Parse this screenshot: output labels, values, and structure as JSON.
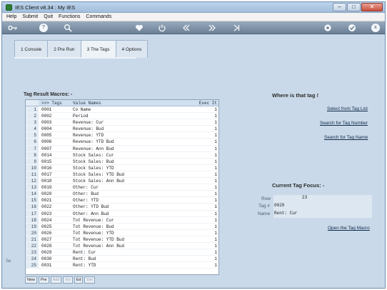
{
  "window": {
    "title": "IES Client v8.34 : My IES",
    "controls": {
      "minimize": "–",
      "maximize": "□",
      "close": "✕"
    }
  },
  "menubar": [
    "Help",
    "Submit",
    "Quit",
    "Functions",
    "Commands"
  ],
  "toolbar": {
    "icons": [
      "key-icon",
      "help-icon",
      "search-icon",
      "heart-icon",
      "power-icon",
      "rewind-icon",
      "forward-icon",
      "end-icon",
      "settings-icon",
      "ok-icon",
      "close-icon"
    ],
    "help_glyph": "?",
    "close_glyph": "x"
  },
  "tabs": [
    {
      "label": "1 Console",
      "active": false
    },
    {
      "label": "2 Pre Run",
      "active": false
    },
    {
      "label": "3 The Tags",
      "active": true
    },
    {
      "label": "4 Options",
      "active": false
    }
  ],
  "left_panel": {
    "heading": "Tag Result Macros: -",
    "columns": {
      "num": "",
      "tags": ">>> Tags",
      "value_names": "Value Names",
      "exec": "Exec It"
    },
    "rows": [
      {
        "num": "1",
        "tag": "0001",
        "name": "Co Name",
        "exec": "1"
      },
      {
        "num": "2",
        "tag": "0002",
        "name": "Period",
        "exec": "1"
      },
      {
        "num": "3",
        "tag": "0003",
        "name": "Revenue: Cur",
        "exec": "1"
      },
      {
        "num": "4",
        "tag": "0004",
        "name": "Revenue: Bud",
        "exec": "1"
      },
      {
        "num": "5",
        "tag": "0005",
        "name": "Revenue: YTD",
        "exec": "1"
      },
      {
        "num": "6",
        "tag": "0006",
        "name": "Revenue: YTD Bud",
        "exec": "1"
      },
      {
        "num": "7",
        "tag": "0007",
        "name": "Revenue: Ann Bud",
        "exec": "1"
      },
      {
        "num": "8",
        "tag": "0014",
        "name": "Stock Sales: Cur",
        "exec": "1"
      },
      {
        "num": "9",
        "tag": "0015",
        "name": "Stock Sales: Bud",
        "exec": "1"
      },
      {
        "num": "10",
        "tag": "0016",
        "name": "Stock Sales: YTD",
        "exec": "1"
      },
      {
        "num": "11",
        "tag": "0017",
        "name": "Stock Sales: YTD Bud",
        "exec": "1"
      },
      {
        "num": "12",
        "tag": "0018",
        "name": "Stock Sales: Ann Bud",
        "exec": "1"
      },
      {
        "num": "13",
        "tag": "0019",
        "name": "Other: Cur",
        "exec": "1"
      },
      {
        "num": "14",
        "tag": "0020",
        "name": "Other: Bud",
        "exec": "1"
      },
      {
        "num": "15",
        "tag": "0021",
        "name": "Other: YTD",
        "exec": "1"
      },
      {
        "num": "16",
        "tag": "0022",
        "name": "Other: YTD Bud",
        "exec": "1"
      },
      {
        "num": "17",
        "tag": "0023",
        "name": "Other: Ann Bud",
        "exec": "1"
      },
      {
        "num": "18",
        "tag": "0024",
        "name": "Tot Revenue: Cur",
        "exec": "1"
      },
      {
        "num": "19",
        "tag": "0025",
        "name": "Tot Revenue: Bud",
        "exec": "1"
      },
      {
        "num": "20",
        "tag": "0026",
        "name": "Tot Revenue: YTD",
        "exec": "1"
      },
      {
        "num": "21",
        "tag": "0027",
        "name": "Tot Revenue: YTD Bud",
        "exec": "1"
      },
      {
        "num": "22",
        "tag": "0028",
        "name": "Tot Revenue: Ann Bud",
        "exec": "1"
      },
      {
        "num": "23",
        "tag": "0029",
        "name": "Rent: Cur",
        "exec": "1"
      },
      {
        "num": "24",
        "tag": "0030",
        "name": "Rent: Bud",
        "exec": "1"
      },
      {
        "num": "25",
        "tag": "0031",
        "name": "Rent: YTD",
        "exec": "1"
      }
    ],
    "nav_buttons": [
      {
        "label": "New",
        "enabled": true
      },
      {
        "label": "Pre",
        "enabled": true
      },
      {
        "label": "Add",
        "enabled": false
      },
      {
        "label": "Ins",
        "enabled": false
      },
      {
        "label": "Ed",
        "enabled": true
      },
      {
        "label": "Del",
        "enabled": false
      }
    ],
    "side_cut_text": "Se"
  },
  "right_panel": {
    "where_heading": "Where is that tag !",
    "links": {
      "select_from_list": "Select from Tag List",
      "search_number": "Search for Tag Number",
      "search_name": "Search for Tag Name",
      "open_macro": "Open the Tag Macro"
    },
    "focus": {
      "heading": "Current Tag Focus: -",
      "row_label": "Row",
      "row_value": "23",
      "tag_label": "Tag #",
      "tag_value": "0029",
      "name_label": "Name",
      "name_value": "Rent: Cur"
    }
  },
  "colors": {
    "background": "#c9d9e9",
    "toolbar": "#6b7f95",
    "table_header": "#cfe0f0",
    "link": "#102a48"
  }
}
